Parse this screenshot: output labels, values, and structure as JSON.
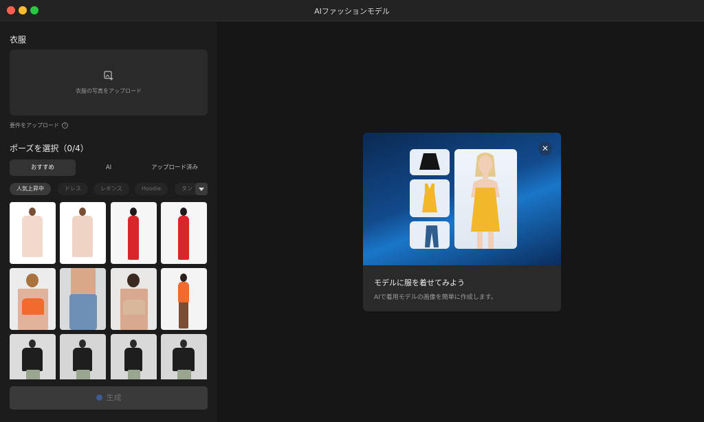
{
  "window": {
    "title": "AIファッションモデル"
  },
  "sidebar": {
    "clothing_title": "衣服",
    "upload_text": "衣服の写真をアップロード",
    "requirements_text": "要件をアップロード",
    "pose_title": "ポーズを選択（0/4）",
    "tabs": [
      {
        "label": "おすすめ"
      },
      {
        "label": "AI"
      },
      {
        "label": "アップロード済み"
      }
    ],
    "chips": [
      {
        "label": "人気上昇中"
      },
      {
        "label": "ドレス"
      },
      {
        "label": "レギンス"
      },
      {
        "label": "Hoodie"
      },
      {
        "label": "タン"
      }
    ],
    "generate_label": "生成"
  },
  "promo": {
    "title": "モデルに服を着せてみよう",
    "subtitle": "AIで着用モデルの画像を簡単に作成します。"
  },
  "colors": {
    "accent_orange": "#f26a2e",
    "accent_red": "#d9262b",
    "dress_yellow": "#f2b72b"
  }
}
